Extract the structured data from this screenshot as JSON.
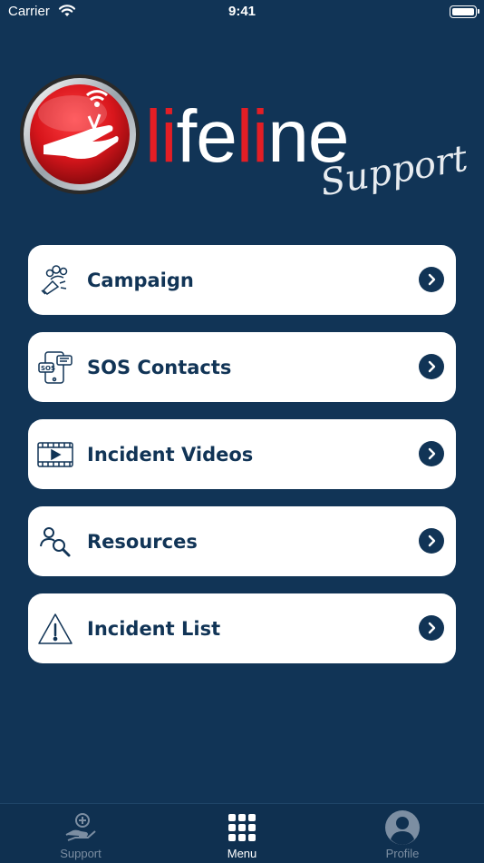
{
  "status_bar": {
    "carrier": "Carrier",
    "time": "9:41"
  },
  "logo": {
    "word_red_1": "li",
    "word_white_1": "fe",
    "word_red_2": "li",
    "word_white_2": "ne",
    "script": "Support"
  },
  "menu": {
    "items": [
      {
        "label": "Campaign",
        "icon": "campaign-icon"
      },
      {
        "label": "SOS Contacts",
        "icon": "sos-contacts-icon"
      },
      {
        "label": "Incident Videos",
        "icon": "video-icon"
      },
      {
        "label": "Resources",
        "icon": "resources-search-icon"
      },
      {
        "label": "Incident List",
        "icon": "warning-icon"
      }
    ]
  },
  "tab_bar": {
    "tabs": [
      {
        "label": "Support",
        "icon": "support-hand-icon",
        "active": false
      },
      {
        "label": "Menu",
        "icon": "grid-icon",
        "active": true
      },
      {
        "label": "Profile",
        "icon": "profile-icon",
        "active": false
      }
    ]
  },
  "colors": {
    "background": "#113456",
    "accent_red": "#e31e25",
    "card": "#ffffff",
    "text_dark": "#113456"
  }
}
